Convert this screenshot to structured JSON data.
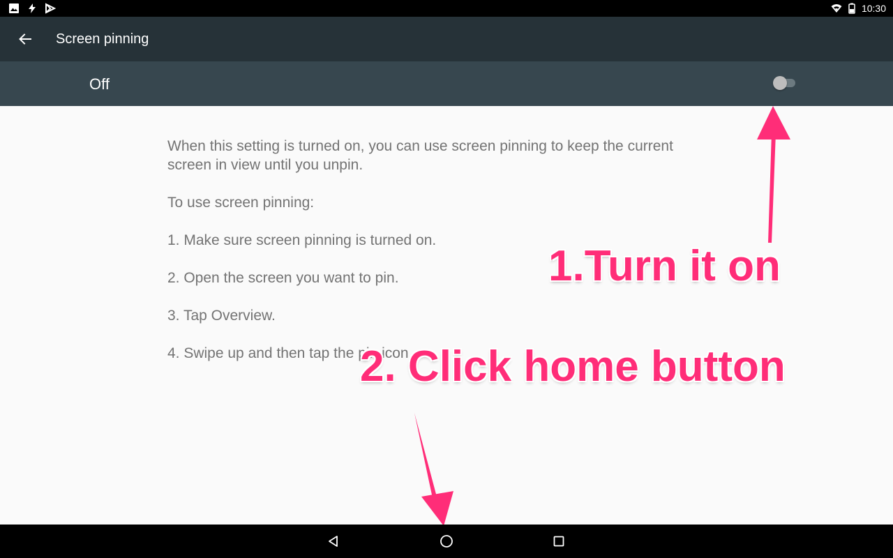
{
  "status_bar": {
    "time": "10:30",
    "left_icons": [
      "image-icon",
      "flash-icon",
      "play-store-icon"
    ],
    "right_icons": [
      "wifi-icon",
      "battery-icon"
    ]
  },
  "toolbar": {
    "back_icon": "arrow-back-icon",
    "title": "Screen pinning"
  },
  "switch_bar": {
    "label": "Off",
    "switch_state": "off"
  },
  "content": {
    "paragraphs": [
      "When this setting is turned on, you can use screen pinning to keep the current screen in view until you unpin.",
      "To use screen pinning:",
      "1. Make sure screen pinning is turned on.",
      "2. Open the screen you want to pin.",
      "3. Tap Overview.",
      "4. Swipe up and then tap the pin icon."
    ]
  },
  "annotations": {
    "step1": "1.Turn it on",
    "step2": "2. Click home button",
    "color": "#ff2d78"
  },
  "nav_bar": {
    "buttons": [
      "back-triangle-icon",
      "home-circle-icon",
      "recents-square-icon"
    ]
  },
  "colors": {
    "toolbar": "#263238",
    "switch_bar": "#37474f",
    "background": "#fafafa",
    "body_text": "#737373"
  }
}
